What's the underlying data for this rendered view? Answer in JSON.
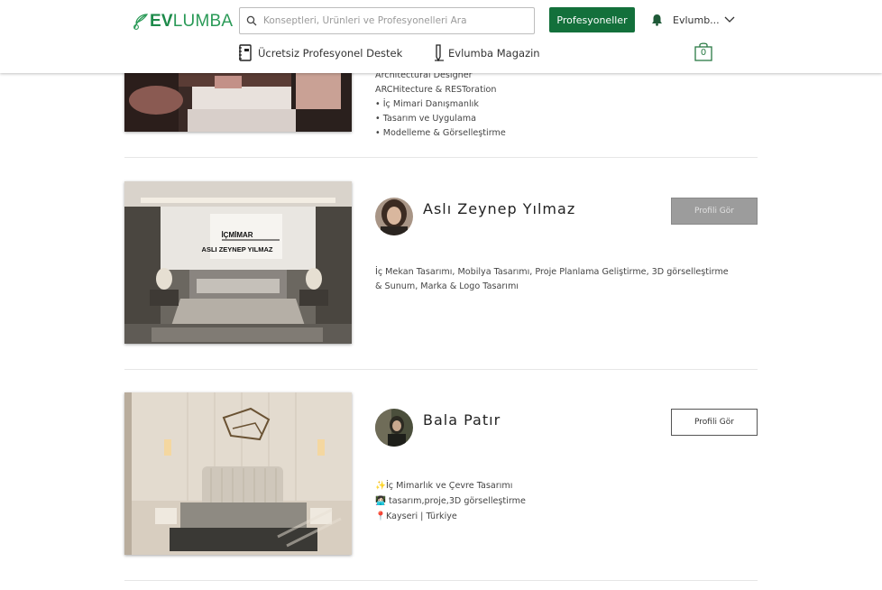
{
  "header": {
    "logo_ev": "EV",
    "logo_rest": "LUMBA",
    "search_placeholder": "Konseptleri, Ürünleri ve Profesyonelleri Ara",
    "professionals_button": "Profesyoneller",
    "user_name": "Evlumb...",
    "nav": [
      {
        "label": "Ücretsiz Profesyonel Destek",
        "icon": "notebook-icon"
      },
      {
        "label": "Evlumba Magazin",
        "icon": "pen-icon"
      }
    ],
    "cart_count": "0"
  },
  "cards": [
    {
      "name": "",
      "button": "",
      "description": [
        "Architectural Designer",
        "ARCHitecture & RESToration",
        "• İç Mimari Danışmanlık",
        "• Tasarım ve Uygulama",
        "• Modelleme & Görselleştirme"
      ]
    },
    {
      "name": "Aslı Zeynep Yılmaz",
      "button": "Profili Gör",
      "image_text_1": "İÇMİMAR",
      "image_text_2": "ASLI ZEYNEP YILMAZ",
      "description": [
        "İç Mekan Tasarımı, Mobilya Tasarımı, Proje Planlama Geliştirme, 3D görselleştirme",
        "& Sunum, Marka & Logo Tasarımı"
      ]
    },
    {
      "name": "Bala Patır",
      "button": "Profili Gör",
      "description": [
        "✨İç Mimarlık ve Çevre Tasarımı",
        "👩🏻‍💻 tasarım,proje,3D görselleştirme",
        "📍Kayseri | Türkiye"
      ]
    }
  ],
  "colors": {
    "brand_green": "#13703b",
    "logo_green": "#1d8a4a",
    "disabled_button": "#9c9c9c"
  }
}
